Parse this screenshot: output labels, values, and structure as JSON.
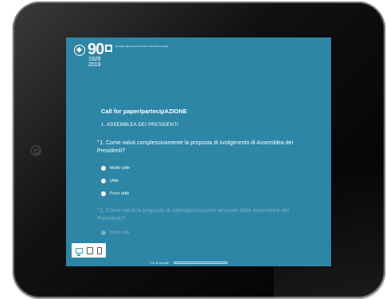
{
  "logo": {
    "number": "90",
    "years": "1929\n2019",
    "org_name": "Consiglio Nazionale Geometri e Geometri Laureati"
  },
  "survey": {
    "title": "Call for paper/partecipAZIONE",
    "section": "1. ASSEMBLEA DEI PRESIDENTI",
    "question1": {
      "required_marker": "*",
      "text": "1. Come valuti complessivamente la proposta di svolgimento di Assemblea dei Presidenti?",
      "options": [
        "Molto utile",
        "Utile",
        "Poco utile"
      ]
    },
    "question2": {
      "required_marker": "*",
      "text": "2. Come valuti la proposta di calendarizzazione annuale delle Assemblee dei Presidenti?",
      "first_option": "Molto utile"
    }
  },
  "footer": {
    "progress_text": "0 di 18 risposte",
    "progress_fraction": 0
  },
  "device_switcher": [
    "desktop-icon",
    "tablet-icon",
    "phone-icon"
  ],
  "colors": {
    "screen_bg": "#2e86a6",
    "active_device": "#2b9fb8"
  }
}
